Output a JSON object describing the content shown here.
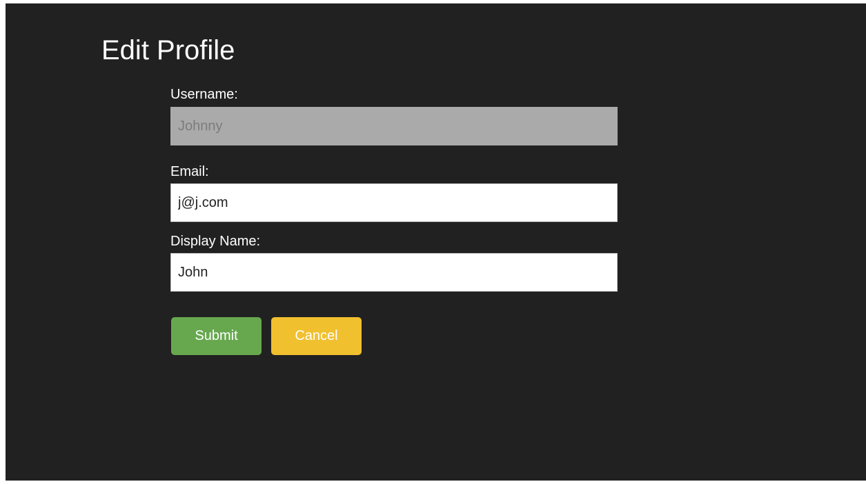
{
  "page": {
    "title": "Edit Profile"
  },
  "form": {
    "username": {
      "label": "Username:",
      "value": "Johnny",
      "disabled": true
    },
    "email": {
      "label": "Email:",
      "value": "j@j.com"
    },
    "display_name": {
      "label": "Display Name:",
      "value": "John"
    }
  },
  "actions": {
    "submit_label": "Submit",
    "cancel_label": "Cancel"
  },
  "colors": {
    "background": "#212121",
    "submit": "#67a84f",
    "cancel": "#f1c02e",
    "disabled_field": "#aaaaaa"
  }
}
